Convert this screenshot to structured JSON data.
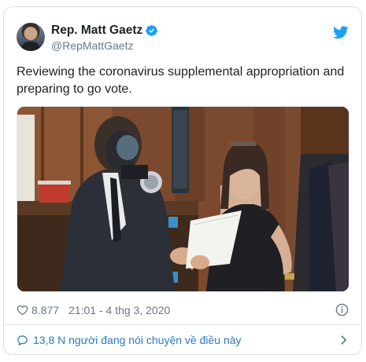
{
  "tweet": {
    "author_name": "Rep. Matt Gaetz",
    "author_handle": "@RepMattGaetz",
    "text": "Reviewing the coronavirus supplemental appropriation and preparing to go vote.",
    "likes": "8.877",
    "timestamp": "21:01 - 4 thg 3, 2020",
    "conversation_link": "13,8 N người đang nói chuyện về điều này"
  },
  "icons": {
    "verified": "verified-badge-icon",
    "logo": "twitter-bird-icon",
    "like": "heart-icon",
    "info": "info-icon",
    "conversation": "speech-bubble-icon",
    "chevron": "chevron-right-icon"
  },
  "colors": {
    "accent": "#1da1f2",
    "link": "#2b7bb9",
    "muted": "#697882",
    "text": "#1c2022"
  }
}
